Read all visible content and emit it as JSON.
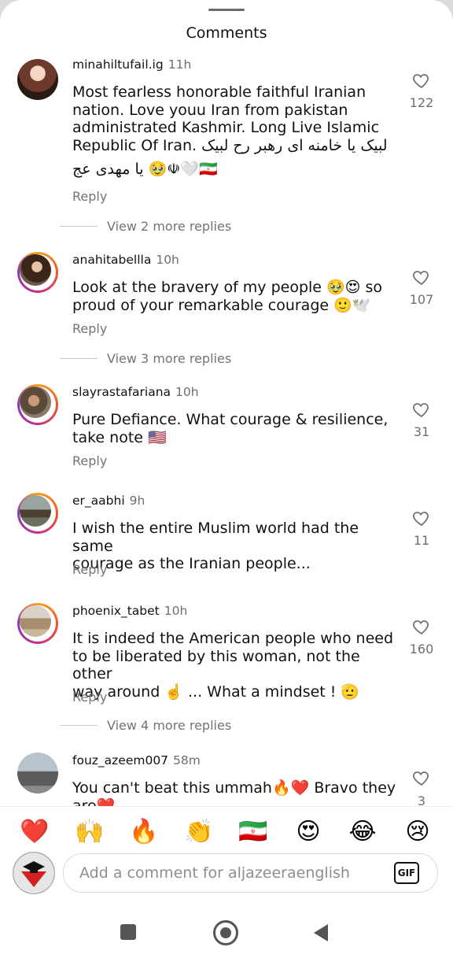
{
  "sheet": {
    "title": "Comments"
  },
  "comments": [
    {
      "username": "minahiltufail.ig",
      "time": "11h",
      "text_lines": [
        "Most fearless honorable faithful Iranian",
        "nation. Love youu Iran from pakistan",
        "administrated Kashmir. Long Live Islamic",
        "Republic Of Iran. لبیک یا خامنه ای رهبر رح لبیک",
        "🇮🇷🤍☫🥹 یا مهدی عج"
      ],
      "reply_label": "Reply",
      "likes": "122",
      "view_more": "View 2 more replies"
    },
    {
      "username": "anahitabellla",
      "time": "10h",
      "text_lines": [
        "Look at the bravery of my people 🥹😍 so",
        "proud of your remarkable courage 🙂🕊️"
      ],
      "reply_label": "Reply",
      "likes": "107",
      "view_more": "View 3 more replies"
    },
    {
      "username": "slayrastafariana",
      "time": "10h",
      "text_lines": [
        "Pure Defiance. What courage & resilience,",
        "take note 🇺🇸"
      ],
      "reply_label": "Reply",
      "likes": "31"
    },
    {
      "username": "er_aabhi",
      "time": "9h",
      "text_lines": [
        "I wish the entire Muslim world had the same",
        "courage as the Iranian people..."
      ],
      "reply_label": "Reply",
      "likes": "11"
    },
    {
      "username": "phoenix_tabet",
      "time": "10h",
      "text_lines": [
        "It is indeed the American people who need",
        "to be liberated by this woman, not the other",
        "way around ☝️ ... What a mindset ! 🫡"
      ],
      "reply_label": "Reply",
      "likes": "160",
      "view_more": "View 4 more replies"
    },
    {
      "username": "fouz_azeem007",
      "time": "58m",
      "text_lines": [
        "You can't beat this ummah🔥❤️ Bravo they",
        "are❤️"
      ],
      "likes": "3"
    }
  ],
  "emoji_bar": [
    "❤️",
    "🙌",
    "🔥",
    "👏",
    "🇮🇷",
    "😍",
    "😂",
    "😢"
  ],
  "composer": {
    "placeholder": "Add a comment for aljazeeraenglish",
    "gif_label": "GIF"
  },
  "colors": {
    "story_ring": "#d6249f",
    "secondary_text": "#737373"
  },
  "icons": {
    "like": "heart-outline-icon",
    "gif": "gif-icon",
    "nav": [
      "recents-icon",
      "home-icon",
      "back-icon"
    ]
  }
}
